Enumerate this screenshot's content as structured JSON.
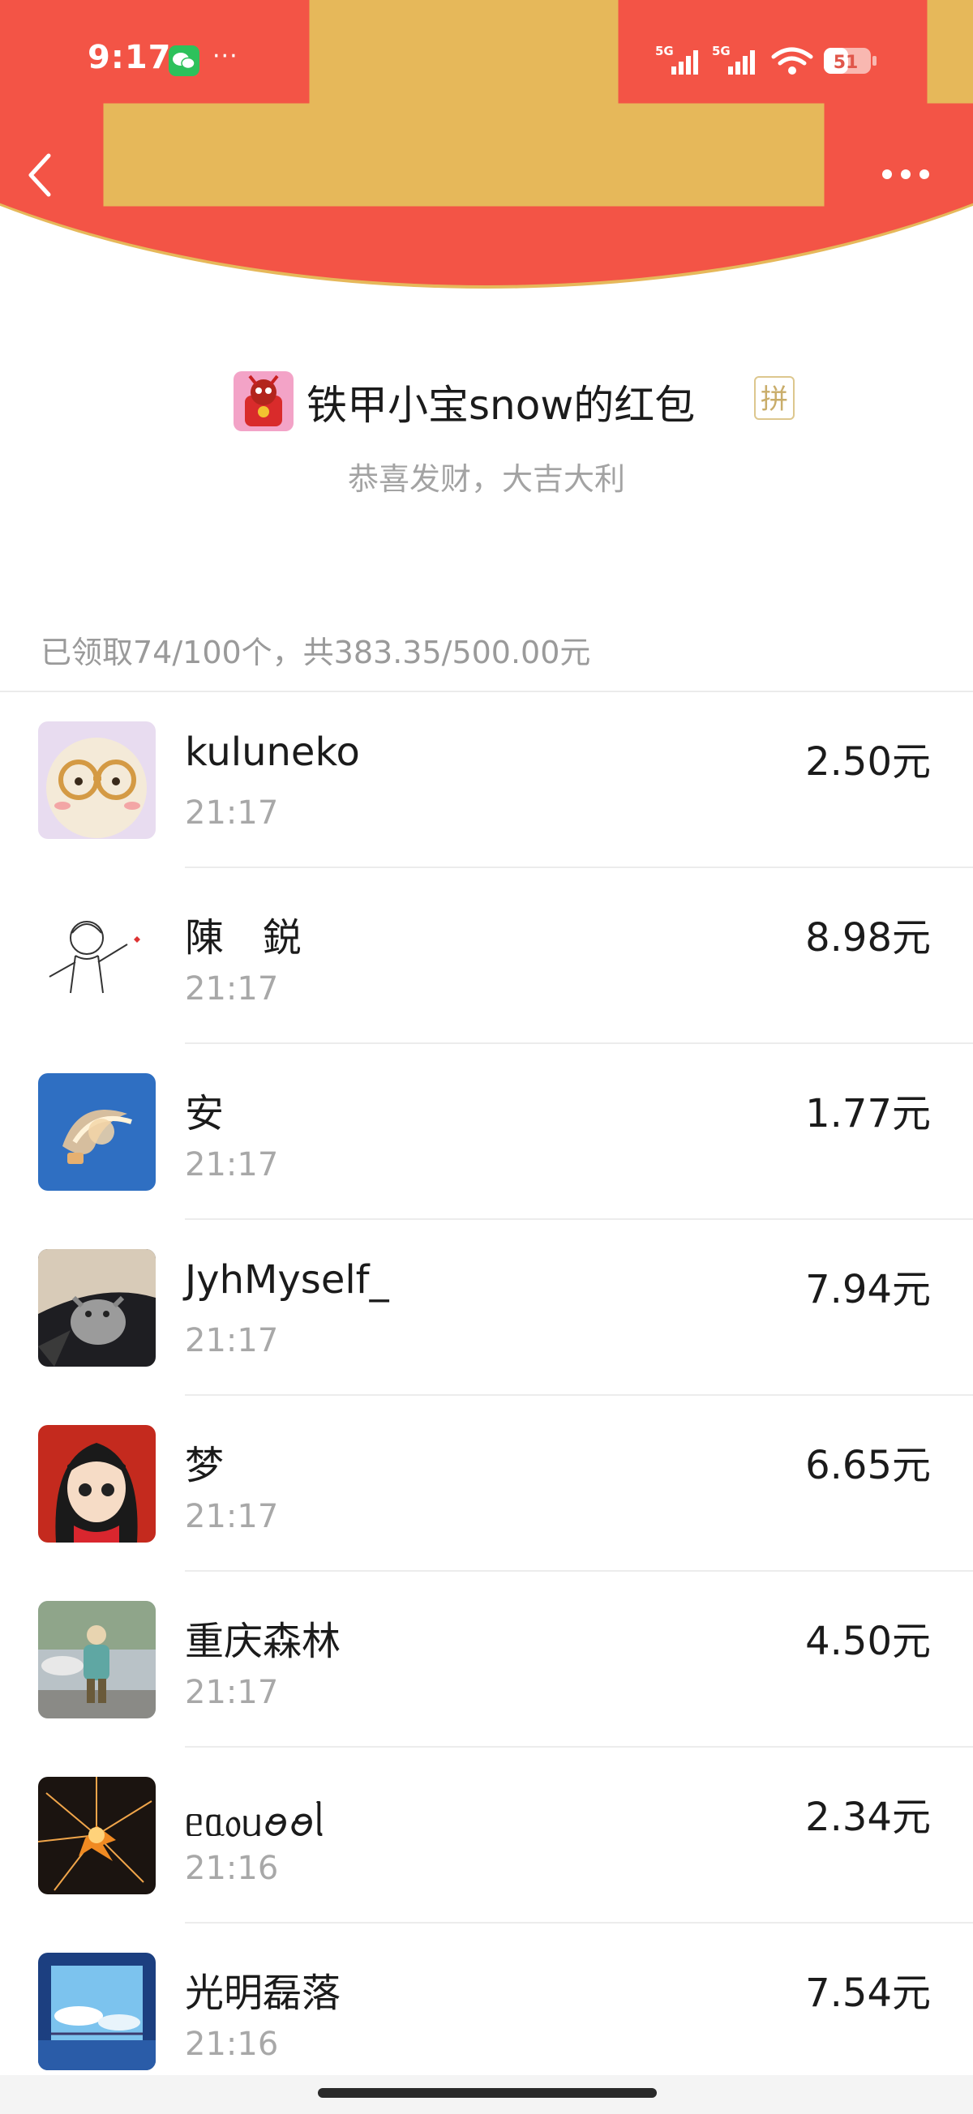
{
  "status_bar": {
    "time": "9:17",
    "more": "···",
    "network1": "5G",
    "network2": "5G",
    "battery": "51"
  },
  "header": {
    "back_icon": "chevron-left-icon",
    "menu_icon": "more-dots-icon",
    "bg_color": "#f35446"
  },
  "packet": {
    "sender_name": "铁甲小宝snow的红包",
    "badge": "拼",
    "blessing": "恭喜发财，大吉大利",
    "summary": "已领取74/100个，共383.35/500.00元"
  },
  "records": [
    {
      "name": "kuluneko",
      "time": "21:17",
      "amount": "2.50元"
    },
    {
      "name": "陳　鋭",
      "time": "21:17",
      "amount": "8.98元"
    },
    {
      "name": "安",
      "time": "21:17",
      "amount": "1.77元"
    },
    {
      "name": "JyhMyself_",
      "time": "21:17",
      "amount": "7.94元"
    },
    {
      "name": "梦",
      "time": "21:17",
      "amount": "6.65元"
    },
    {
      "name": "重庆森林",
      "time": "21:17",
      "amount": "4.50元"
    },
    {
      "name": "ᥱᥲ᥆ᥙꪮꪮᥣ",
      "time": "21:16",
      "amount": "2.34元"
    },
    {
      "name": "光明磊落",
      "time": "21:16",
      "amount": "7.54元"
    }
  ]
}
